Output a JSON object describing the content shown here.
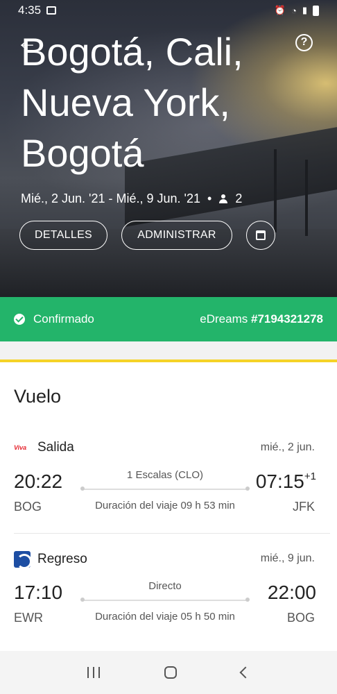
{
  "status_bar": {
    "time": "4:35"
  },
  "hero": {
    "title_lines": [
      "Bogotá, Cali,",
      "Nueva York,",
      "Bogotá"
    ],
    "dates": "Mié., 2 Jun. '21 - Mié., 9 Jun. '21",
    "separator": "•",
    "passengers": "2",
    "details_label": "DETALLES",
    "manage_label": "ADMINISTRAR"
  },
  "confirmation": {
    "status": "Confirmado",
    "brand": "eDreams",
    "booking_ref": "#7194321278"
  },
  "flight_section": {
    "title": "Vuelo",
    "outbound": {
      "label": "Salida",
      "airline_logo_text": "Viva",
      "date": "mié., 2 jun.",
      "dep_time": "20:22",
      "dep_code": "BOG",
      "stops": "1 Escalas (CLO)",
      "duration": "Duración del viaje 09 h 53 min",
      "arr_time": "07:15",
      "arr_plus": "+1",
      "arr_code": "JFK"
    },
    "inbound": {
      "label": "Regreso",
      "date": "mié., 9 jun.",
      "dep_time": "17:10",
      "dep_code": "EWR",
      "stops": "Directo",
      "duration": "Duración del viaje 05 h 50 min",
      "arr_time": "22:00",
      "arr_code": "BOG"
    }
  },
  "colors": {
    "confirmed_green": "#23b46a",
    "accent_yellow": "#f5d327"
  }
}
